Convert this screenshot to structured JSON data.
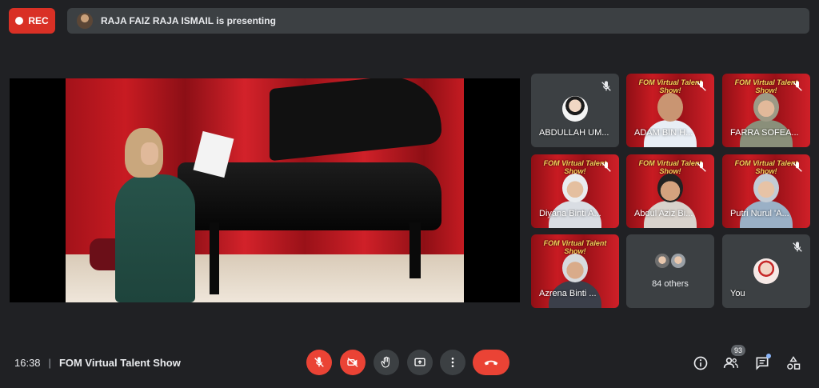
{
  "recording": {
    "label": "REC"
  },
  "presenting": {
    "text": "RAJA FAIZ RAJA ISMAIL is presenting"
  },
  "tiles": [
    {
      "name": "ABDULLAH UM...",
      "kind": "avatar"
    },
    {
      "name": "ADAM BIN H...",
      "kind": "stage",
      "banner": "FOM Virtual Talent Show!"
    },
    {
      "name": "FARRA SOFEA...",
      "kind": "stage",
      "banner": "FOM Virtual Talent Show!"
    },
    {
      "name": "Diyana Binti A...",
      "kind": "stage",
      "banner": "FOM Virtual Talent Show!"
    },
    {
      "name": "Abdul Aziz Bi...",
      "kind": "stage",
      "banner": "FOM Virtual Talent Show!"
    },
    {
      "name": "Putri Nurul 'A...",
      "kind": "stage",
      "banner": "FOM Virtual Talent Show!"
    },
    {
      "name": "Azrena Binti ...",
      "kind": "stage",
      "banner": "FOM Virtual Talent Show!"
    }
  ],
  "others": {
    "label": "84 others"
  },
  "self": {
    "name": "You"
  },
  "footer": {
    "time": "16:38",
    "separator": "|",
    "meeting_title": "FOM Virtual Talent Show"
  },
  "people_count": "93",
  "colors": {
    "accent_red": "#ea4335",
    "bar": "#3c4043",
    "background": "#202124"
  },
  "icons": [
    "mic-off-icon",
    "camera-off-icon",
    "raise-hand-icon",
    "present-icon",
    "more-icon",
    "end-call-icon",
    "info-icon",
    "people-icon",
    "chat-icon",
    "activities-icon"
  ]
}
